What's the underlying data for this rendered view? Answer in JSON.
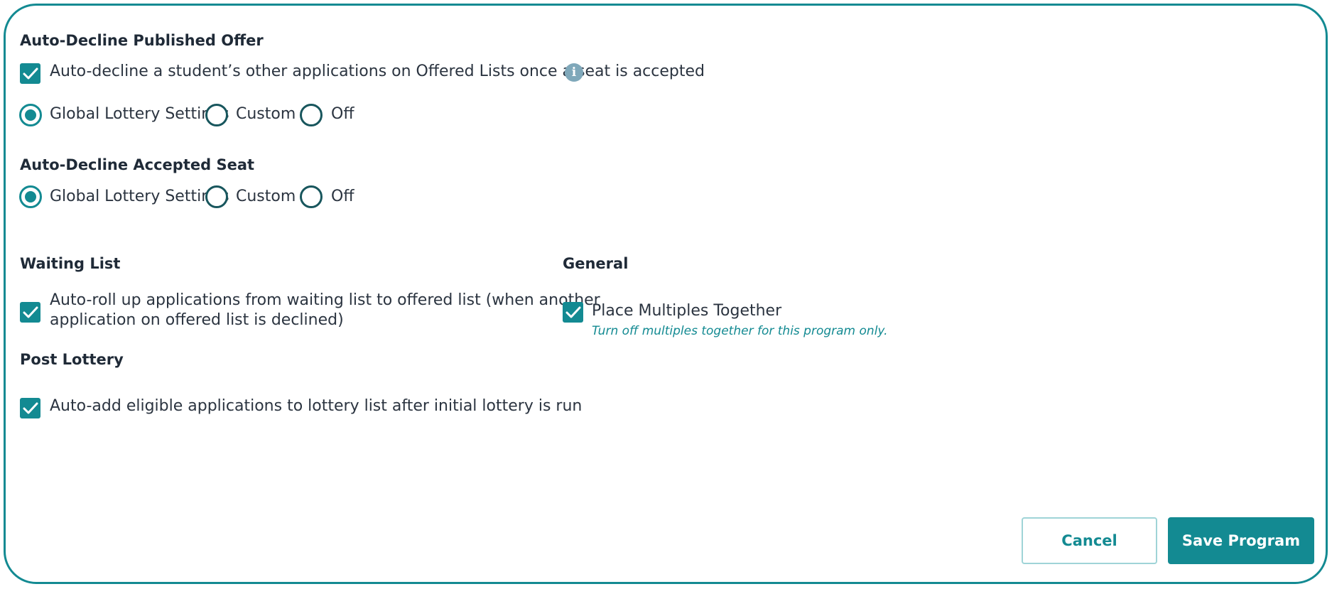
{
  "sections": {
    "auto_decline_offer": {
      "title": "Auto-Decline Published Offer",
      "checkbox_label": "Auto-decline a student’s other applications on Offered Lists once a seat is accepted",
      "checked": true,
      "info_icon": "info-icon",
      "radio_options": [
        "Global Lottery Settings",
        "Custom",
        "Off"
      ],
      "selected": "Global Lottery Settings"
    },
    "auto_decline_seat": {
      "title": "Auto-Decline Accepted Seat",
      "radio_options": [
        "Global Lottery Settings",
        "Custom",
        "Off"
      ],
      "selected": "Global Lottery Settings"
    },
    "waiting_list": {
      "title": "Waiting List",
      "checkbox_label_line1": "Auto-roll up applications from waiting list to offered list (when another",
      "checkbox_label_line2": "application on offered list is declined)",
      "checked": true
    },
    "general": {
      "title": "General",
      "checkbox_label": "Place Multiples Together",
      "hint": "Turn off multiples together for this program only.",
      "checked": true
    },
    "post_lottery": {
      "title": "Post Lottery",
      "checkbox_label": "Auto-add eligible applications to lottery list after initial lottery is run",
      "checked": true
    }
  },
  "buttons": {
    "cancel": "Cancel",
    "save": "Save Program"
  },
  "colors": {
    "accent": "#138a92",
    "radio_border": "#18565d",
    "info_icon": "#7fa8ba"
  }
}
